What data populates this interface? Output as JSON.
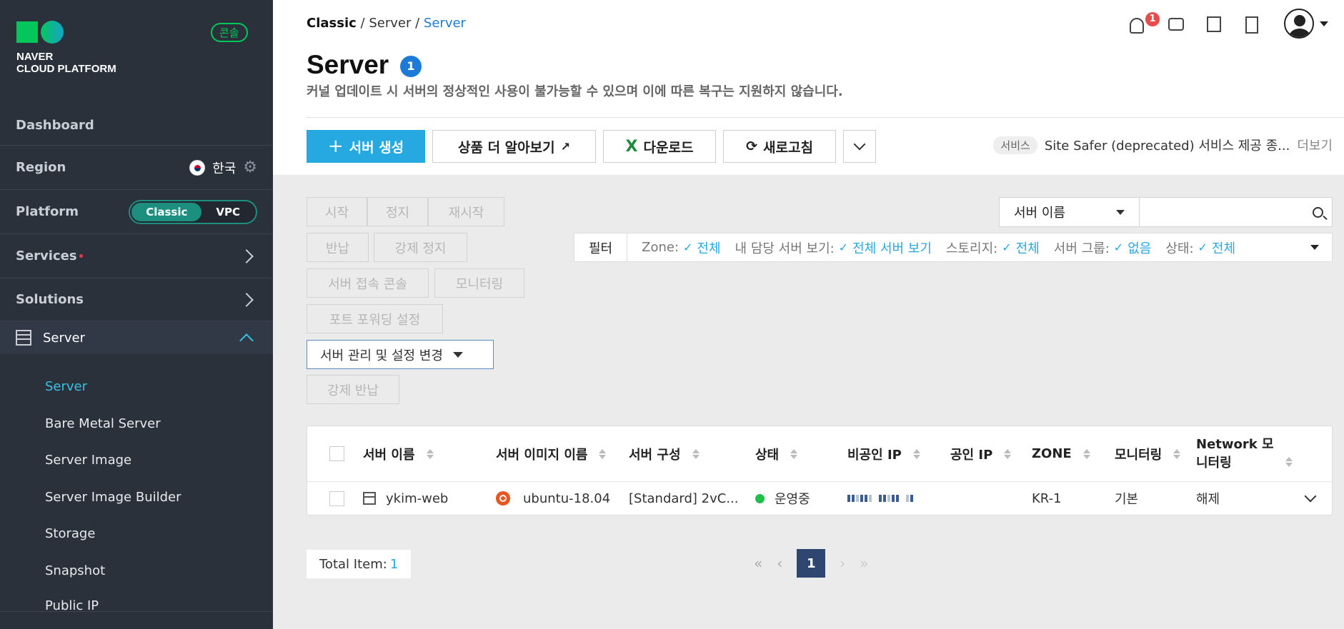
{
  "brand": {
    "line1": "NAVER",
    "line2": "CLOUD PLATFORM",
    "console_badge": "콘솔"
  },
  "sidebar": {
    "dashboard": "Dashboard",
    "region_label": "Region",
    "region_value": "한국",
    "platform_label": "Platform",
    "platform_options": [
      "Classic",
      "VPC"
    ],
    "services": "Services",
    "solutions": "Solutions",
    "server": "Server",
    "sub_items": [
      "Server",
      "Bare Metal Server",
      "Server Image",
      "Server Image Builder",
      "Storage",
      "Snapshot",
      "Public IP"
    ]
  },
  "breadcrumb": {
    "a": "Classic",
    "sep": "/",
    "b": "Server",
    "c": "Server"
  },
  "header": {
    "notification_count": "1"
  },
  "page": {
    "title": "Server",
    "count": "1",
    "subtitle": "커널 업데이트 시 서버의 정상적인 사용이 불가능할 수 있으며 이에 따른 복구는 지원하지 않습니다."
  },
  "actions": {
    "create": "서버 생성",
    "learn_more": "상품 더 알아보기",
    "download": "다운로드",
    "refresh": "새로고침"
  },
  "notice": {
    "tag": "서비스",
    "text": "Site Safer (deprecated) 서비스 제공 종...",
    "more": "더보기"
  },
  "ops": {
    "start": "시작",
    "stop": "정지",
    "restart": "재시작",
    "return": "반납",
    "force_stop": "강제 정지",
    "console": "서버 접속 콘솔",
    "monitoring": "모니터링",
    "port_forward": "포트 포워딩 설정",
    "manage": "서버 관리 및 설정 변경",
    "force_return": "강제 반납"
  },
  "search": {
    "select": "서버 이름",
    "placeholder": ""
  },
  "filter": {
    "label": "필터",
    "zone_k": "Zone:",
    "zone_v": "전체",
    "mine_k": "내 담당 서버 보기:",
    "mine_v": "전체 서버 보기",
    "storage_k": "스토리지:",
    "storage_v": "전체",
    "group_k": "서버 그룹:",
    "group_v": "없음",
    "state_k": "상태:",
    "state_v": "전체"
  },
  "table": {
    "headers": {
      "name": "서버 이름",
      "image": "서버 이미지 이름",
      "spec": "서버 구성",
      "state": "상태",
      "private_ip": "비공인 IP",
      "public_ip": "공인 IP",
      "zone": "ZONE",
      "monitoring": "모니터링",
      "netmon_1": "Network 모",
      "netmon_2": "니터링"
    },
    "rows": [
      {
        "name": "ykim-web",
        "image": "ubuntu-18.04",
        "spec": "[Standard] 2vC...",
        "state": "운영중",
        "zone": "KR-1",
        "monitoring": "기본",
        "netmon": "해제"
      }
    ]
  },
  "footer": {
    "total_label": "Total Item:",
    "total_value": "1",
    "page": "1"
  }
}
